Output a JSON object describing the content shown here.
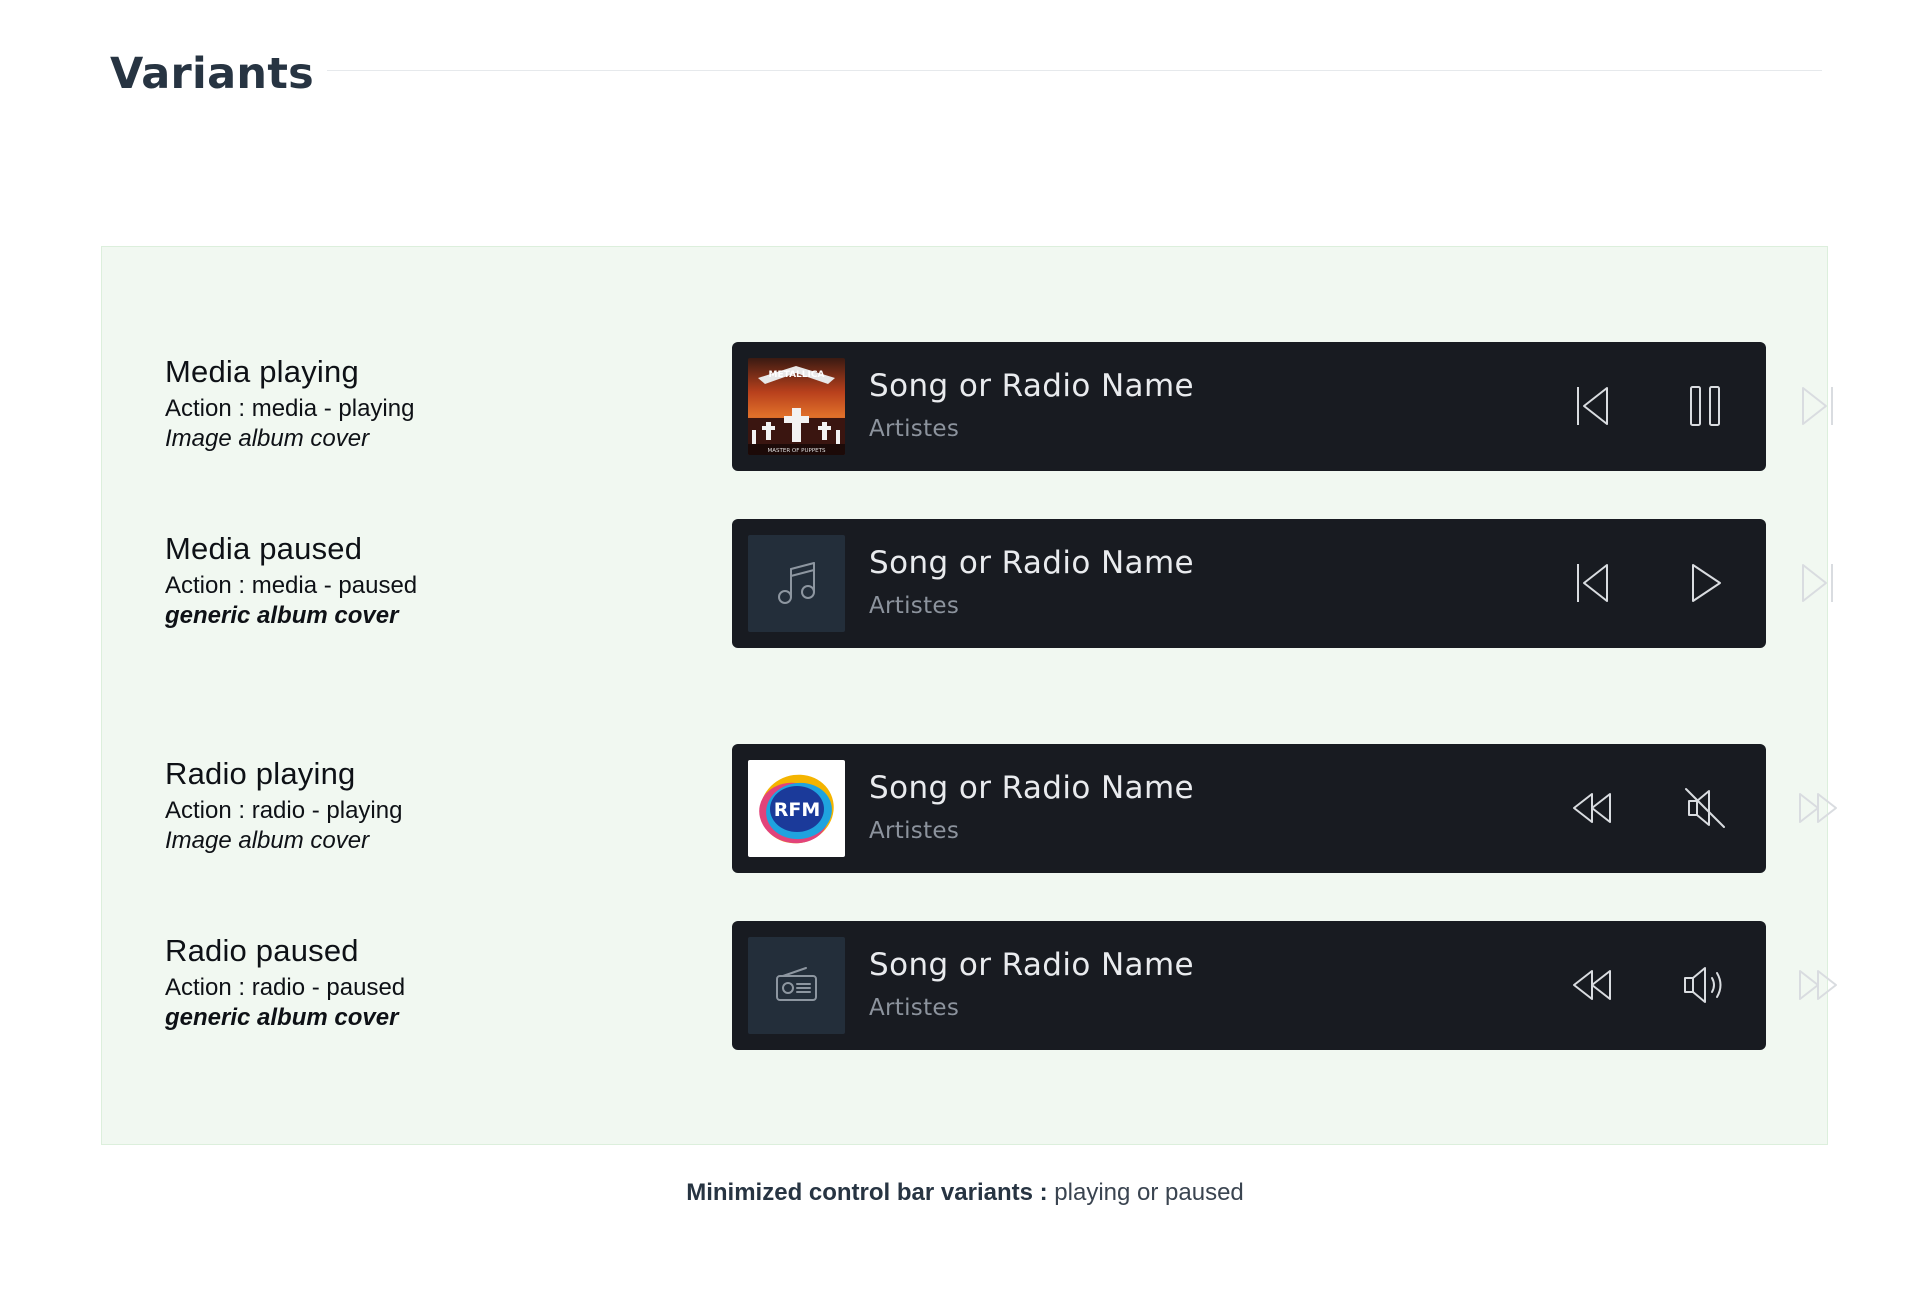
{
  "section": {
    "title": "Variants"
  },
  "variants": [
    {
      "title": "Media playing",
      "action": "Action : media - playing",
      "cover_note": "Image album cover",
      "cover_type": "album-image",
      "album_text": "MASTER OF PUPPETS",
      "band_text": "METALLICA",
      "track_title": "Song or Radio Name",
      "artist": "Artistes",
      "controls": [
        "skip-previous-icon",
        "pause-icon",
        "skip-next-icon"
      ]
    },
    {
      "title": "Media paused",
      "action": "Action : media - paused",
      "cover_note": "generic album cover",
      "cover_type": "generic-music",
      "track_title": "Song or Radio Name",
      "artist": "Artistes",
      "controls": [
        "skip-previous-icon",
        "play-icon",
        "skip-next-icon"
      ]
    },
    {
      "title": "Radio playing",
      "action": "Action : radio - playing",
      "cover_note": "Image album cover",
      "cover_type": "radio-logo",
      "logo_text": "RFM",
      "track_title": "Song or Radio Name",
      "artist": "Artistes",
      "controls": [
        "rewind-icon",
        "volume-mute-icon",
        "fast-forward-icon"
      ]
    },
    {
      "title": "Radio paused",
      "action": "Action : radio - paused",
      "cover_note": "generic album cover",
      "cover_type": "generic-radio",
      "track_title": "Song or Radio Name",
      "artist": "Artistes",
      "controls": [
        "rewind-icon",
        "volume-on-icon",
        "fast-forward-icon"
      ]
    }
  ],
  "caption": {
    "bold": "Minimized control bar variants :",
    "text": " playing or paused"
  },
  "colors": {
    "panel_bg": "#f1f8f1",
    "bar_bg": "#181b21",
    "title_text": "#273442",
    "track_text": "#e9ebee",
    "artist_text": "#8c939d",
    "icon_stroke": "#d9dce0",
    "generic_cover_bg": "#232e3a"
  }
}
